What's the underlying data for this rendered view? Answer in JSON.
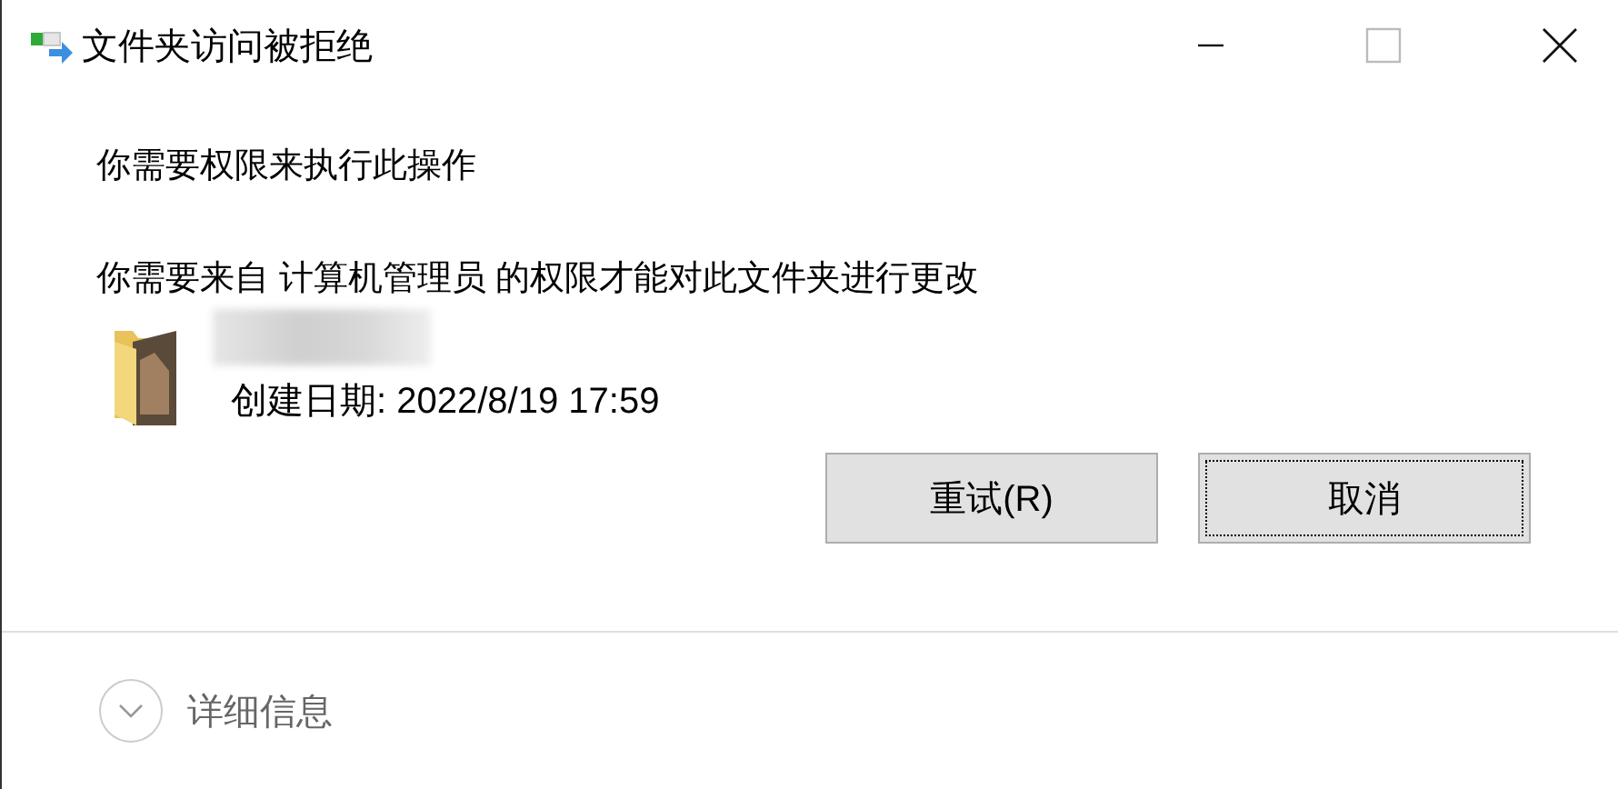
{
  "window": {
    "title": "文件夹访问被拒绝"
  },
  "messages": [
    "你需要权限来执行此操作",
    "你需要来自 计算机管理员 的权限才能对此文件夹进行更改"
  ],
  "file": {
    "created": "创建日期: 2022/8/19 17:59"
  },
  "buttons": [
    {
      "label": "重试(R)",
      "focused": false
    },
    {
      "label": "取消",
      "focused": true
    }
  ],
  "details": {
    "label": "详细信息",
    "expanded": false
  }
}
